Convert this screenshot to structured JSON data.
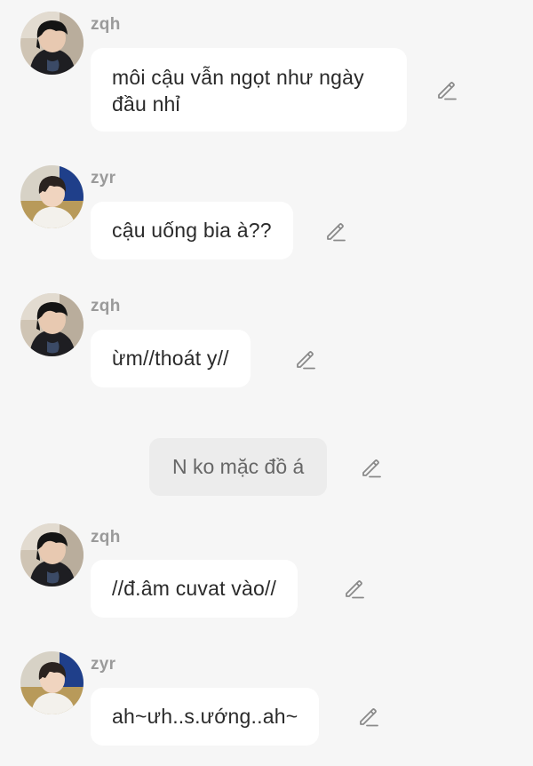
{
  "messages": [
    {
      "type": "chat",
      "sender": "zqh",
      "avatar": "avatar-zqh",
      "text": "môi cậu vẫn ngọt như ngày đầu nhỉ",
      "edit_icon": "pencil-icon"
    },
    {
      "type": "chat",
      "sender": "zyr",
      "avatar": "avatar-zyr",
      "text": "cậu uống bia à??",
      "edit_icon": "pencil-icon"
    },
    {
      "type": "chat",
      "sender": "zqh",
      "avatar": "avatar-zqh",
      "text": "ừm//thoát y//",
      "edit_icon": "pencil-icon"
    },
    {
      "type": "narration",
      "text": "N ko mặc đồ á",
      "edit_icon": "pencil-icon"
    },
    {
      "type": "chat",
      "sender": "zqh",
      "avatar": "avatar-zqh",
      "text": "//đ.âm cuvat vào//",
      "edit_icon": "pencil-icon"
    },
    {
      "type": "chat",
      "sender": "zyr",
      "avatar": "avatar-zyr",
      "text": "ah~ưh..s.ướng..ah~",
      "edit_icon": "pencil-icon"
    }
  ],
  "colors": {
    "background": "#f6f6f6",
    "bubble": "#ffffff",
    "narration_bubble": "#ececec",
    "sender_name": "#9a9a9a",
    "icon": "#8a8a8a"
  }
}
